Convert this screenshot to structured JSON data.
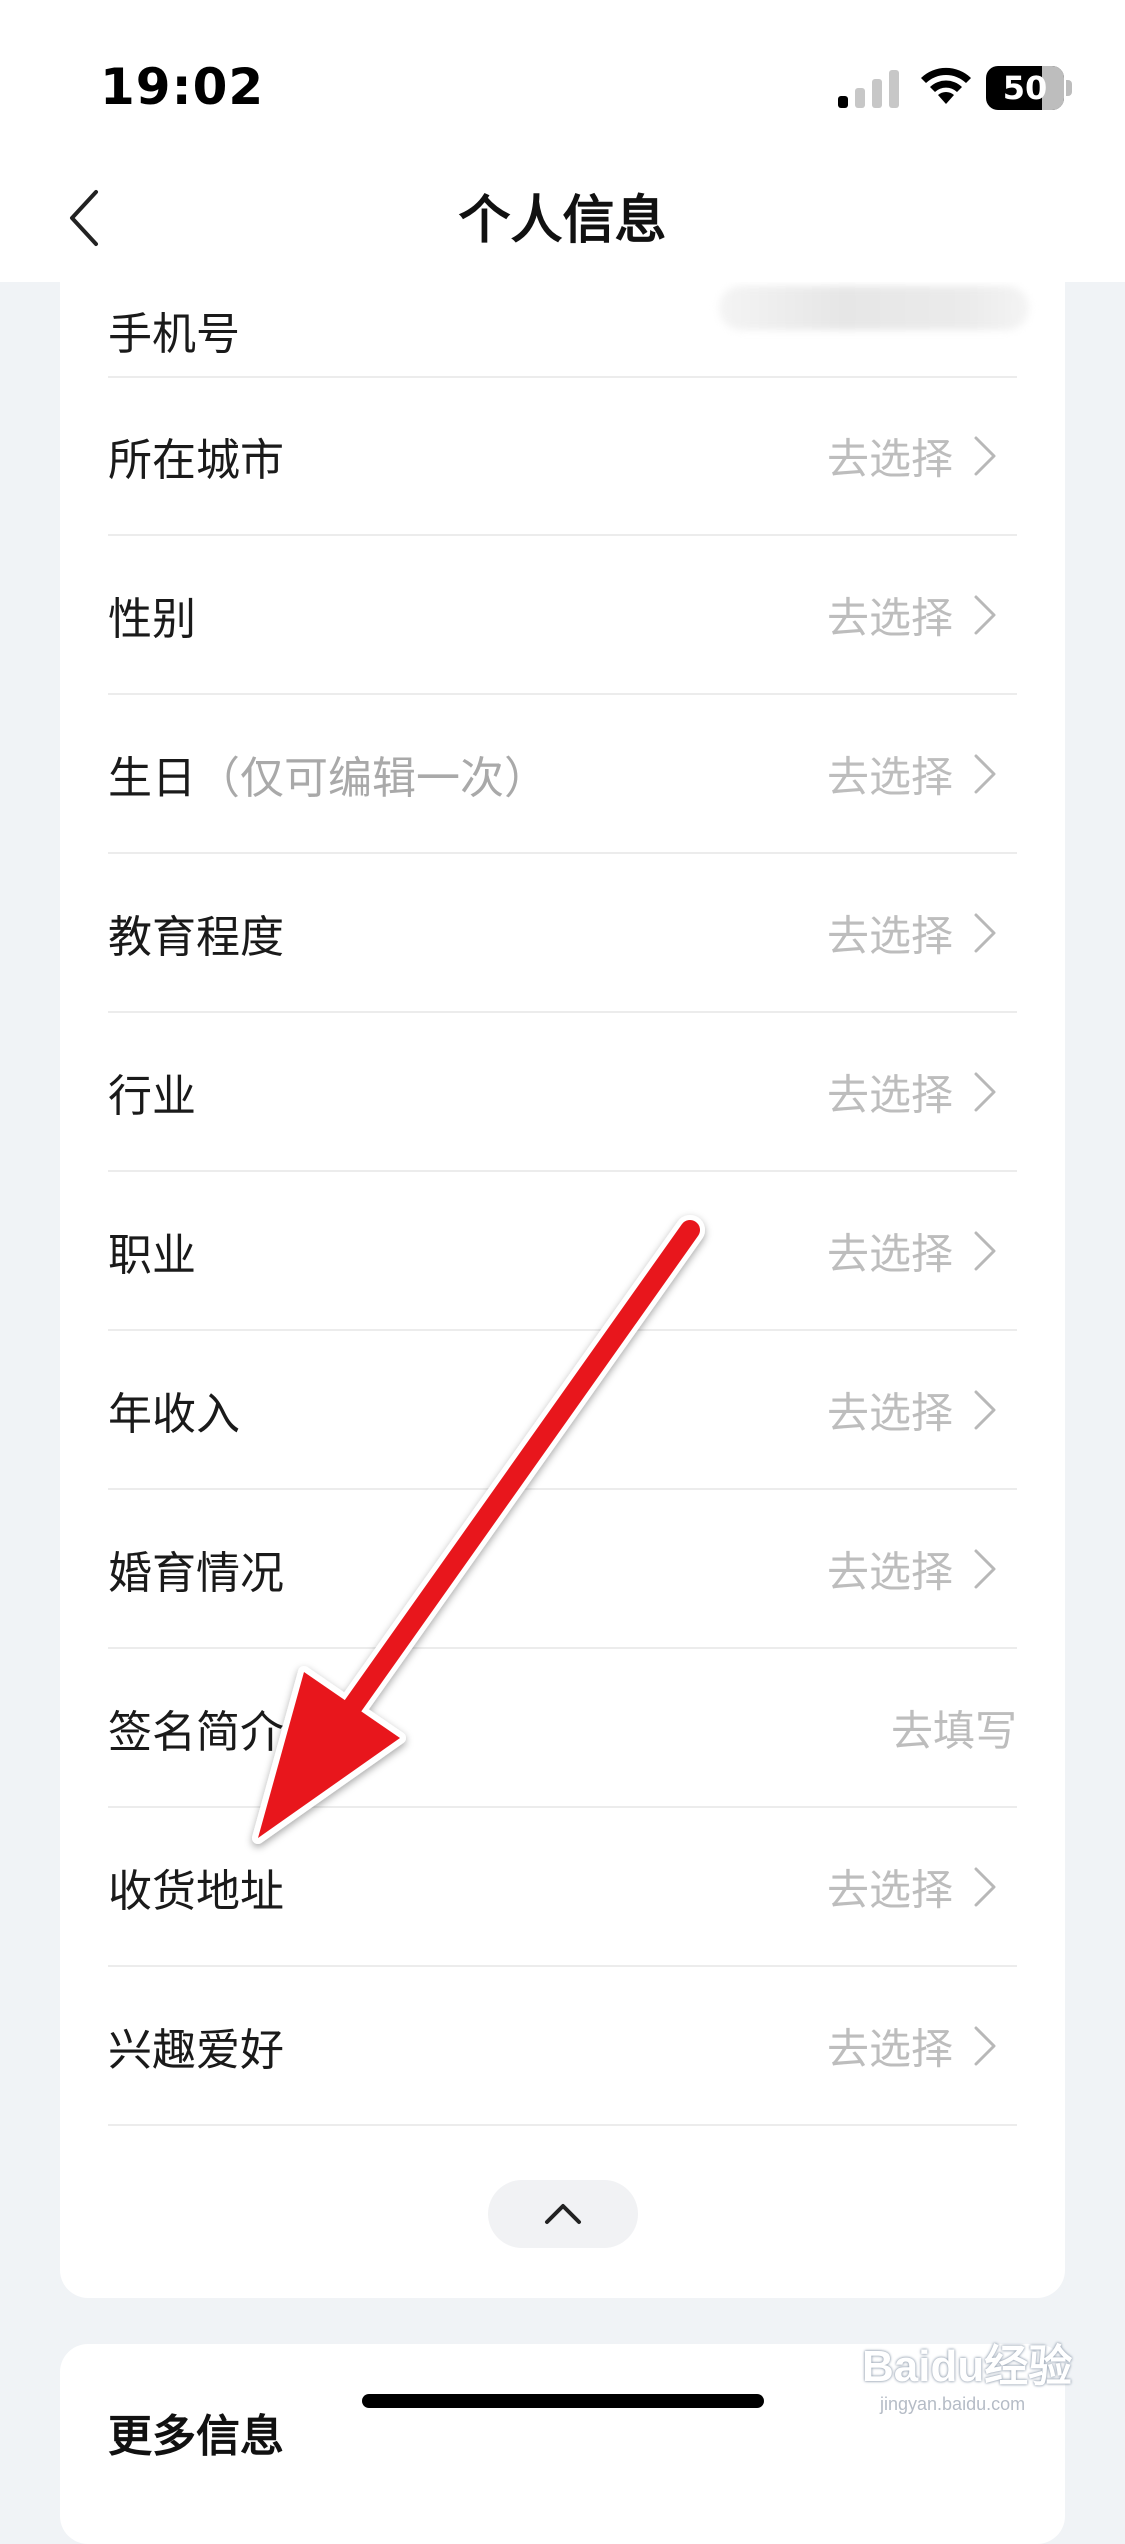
{
  "status_bar": {
    "time": "19:02",
    "battery": "50"
  },
  "nav": {
    "title": "个人信息"
  },
  "profile": {
    "phone_label": "手机号",
    "rows": [
      {
        "label": "所在城市",
        "note": "",
        "value": "去选择",
        "chevron": true
      },
      {
        "label": "性别",
        "note": "",
        "value": "去选择",
        "chevron": true
      },
      {
        "label": "生日",
        "note": "（仅可编辑一次）",
        "value": "去选择",
        "chevron": true
      },
      {
        "label": "教育程度",
        "note": "",
        "value": "去选择",
        "chevron": true
      },
      {
        "label": "行业",
        "note": "",
        "value": "去选择",
        "chevron": true
      },
      {
        "label": "职业",
        "note": "",
        "value": "去选择",
        "chevron": true
      },
      {
        "label": "年收入",
        "note": "",
        "value": "去选择",
        "chevron": true
      },
      {
        "label": "婚育情况",
        "note": "",
        "value": "去选择",
        "chevron": true
      },
      {
        "label": "签名简介",
        "note": "",
        "value": "去填写",
        "chevron": false
      },
      {
        "label": "收货地址",
        "note": "",
        "value": "去选择",
        "chevron": true
      },
      {
        "label": "兴趣爱好",
        "note": "",
        "value": "去选择",
        "chevron": true
      }
    ]
  },
  "more_info": {
    "title": "更多信息"
  },
  "icons": {
    "back": "chevron-left-icon",
    "row_chevron": "chevron-right-icon",
    "collapse": "chevron-up-icon",
    "signal": "cellular-signal-icon",
    "wifi": "wifi-icon",
    "battery": "battery-icon"
  },
  "annotation": {
    "arrow_color": "#e8141b",
    "target_row": "收货地址"
  },
  "watermark": {
    "brand": "Baidu经验",
    "url": "jingyan.baidu.com"
  }
}
